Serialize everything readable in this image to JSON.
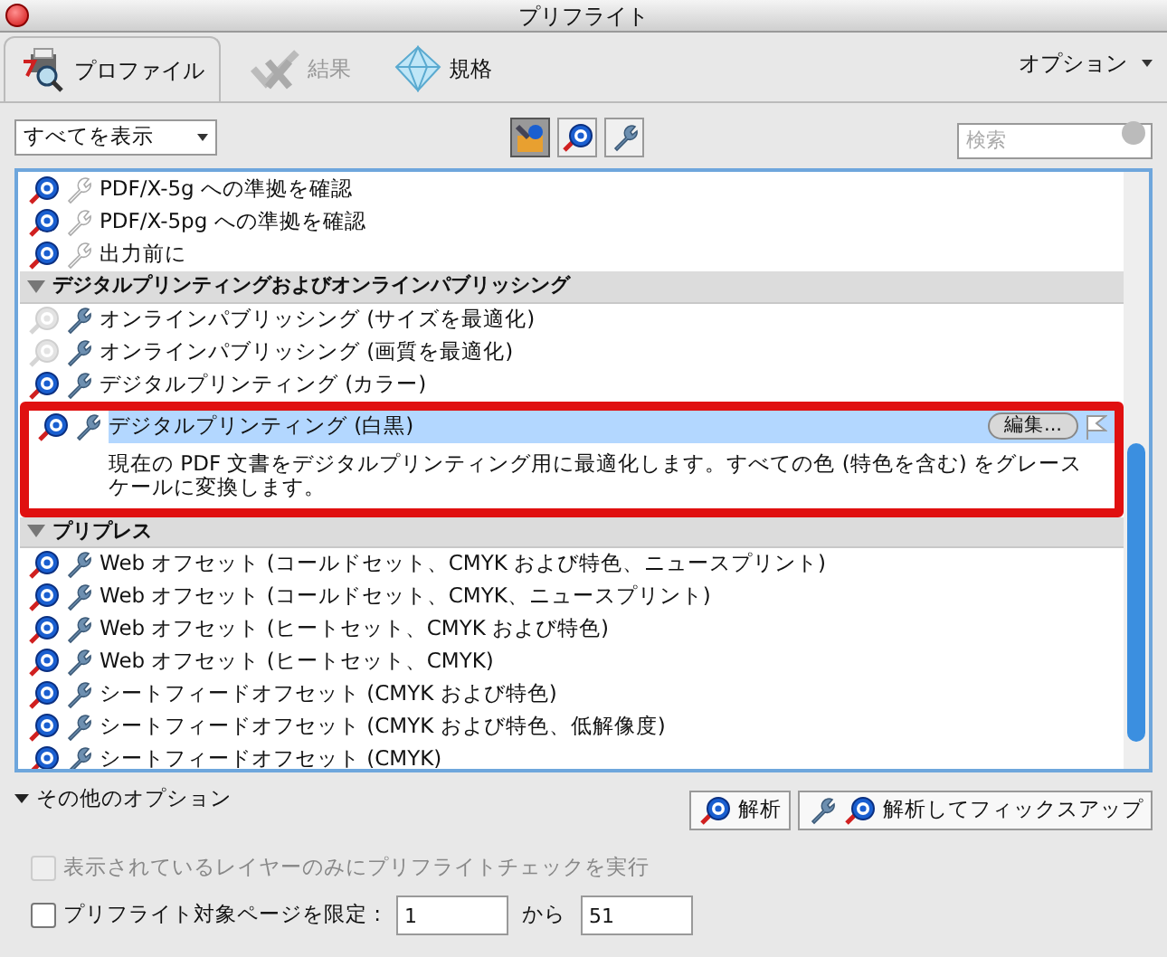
{
  "window": {
    "title": "プリフライト"
  },
  "tabs": [
    {
      "label": "プロファイル",
      "kind": "profiles",
      "selected": true,
      "disabled": false
    },
    {
      "label": "結果",
      "kind": "results",
      "selected": false,
      "disabled": true
    },
    {
      "label": "規格",
      "kind": "standards",
      "selected": false,
      "disabled": false
    }
  ],
  "options_menu": {
    "label": "オプション"
  },
  "filter": {
    "value": "すべてを表示"
  },
  "filter_buttons": [
    {
      "kind": "all",
      "selected": true
    },
    {
      "kind": "analyze",
      "selected": false
    },
    {
      "kind": "fix",
      "selected": false
    }
  ],
  "search": {
    "placeholder": "検索"
  },
  "list": [
    {
      "kind": "item",
      "label": "PDF/X-5g への準拠を確認",
      "analyze": true,
      "fix": false,
      "selected": false
    },
    {
      "kind": "item",
      "label": "PDF/X-5pg への準拠を確認",
      "analyze": true,
      "fix": false,
      "selected": false
    },
    {
      "kind": "item",
      "label": "出力前に",
      "analyze": true,
      "fix": false,
      "selected": false
    },
    {
      "kind": "group",
      "label": "デジタルプリンティングおよびオンラインパブリッシング",
      "expanded": true
    },
    {
      "kind": "item",
      "label": "オンラインパブリッシング (サイズを最適化)",
      "analyze": false,
      "fix": true,
      "selected": false
    },
    {
      "kind": "item",
      "label": "オンラインパブリッシング (画質を最適化)",
      "analyze": false,
      "fix": true,
      "selected": false
    },
    {
      "kind": "item",
      "label": "デジタルプリンティング (カラー)",
      "analyze": true,
      "fix": true,
      "selected": false
    },
    {
      "kind": "item",
      "label": "デジタルプリンティング (白黒)",
      "analyze": true,
      "fix": true,
      "selected": true,
      "highlighted": true,
      "edit_button": "編集...",
      "description": "現在の PDF 文書をデジタルプリンティング用に最適化します。すべての色 (特色を含む) をグレースケールに変換します。"
    },
    {
      "kind": "group",
      "label": "プリプレス",
      "expanded": true
    },
    {
      "kind": "item",
      "label": "Web オフセット (コールドセット、CMYK および特色、ニュースプリント)",
      "analyze": true,
      "fix": true,
      "selected": false
    },
    {
      "kind": "item",
      "label": "Web オフセット (コールドセット、CMYK、ニュースプリント)",
      "analyze": true,
      "fix": true,
      "selected": false
    },
    {
      "kind": "item",
      "label": "Web オフセット (ヒートセット、CMYK および特色)",
      "analyze": true,
      "fix": true,
      "selected": false
    },
    {
      "kind": "item",
      "label": "Web オフセット (ヒートセット、CMYK)",
      "analyze": true,
      "fix": true,
      "selected": false
    },
    {
      "kind": "item",
      "label": "シートフィードオフセット (CMYK および特色)",
      "analyze": true,
      "fix": true,
      "selected": false
    },
    {
      "kind": "item",
      "label": "シートフィードオフセット (CMYK および特色、低解像度)",
      "analyze": true,
      "fix": true,
      "selected": false
    },
    {
      "kind": "item",
      "label": "シートフィードオフセット (CMYK)",
      "analyze": true,
      "fix": true,
      "selected": false
    }
  ],
  "more_options": {
    "label": "その他のオプション",
    "expanded": true
  },
  "buttons": [
    {
      "label": "解析",
      "kind": "analyze"
    },
    {
      "label": "解析してフィックスアップ",
      "kind": "fix"
    }
  ],
  "checks": [
    {
      "label": "表示されているレイヤーのみにプリフライトチェックを実行",
      "checked": false,
      "disabled": true
    },
    {
      "label": "プリフライト対象ページを限定 :",
      "checked": false,
      "disabled": false,
      "from": "1",
      "joiner": "から",
      "to": "51"
    }
  ]
}
